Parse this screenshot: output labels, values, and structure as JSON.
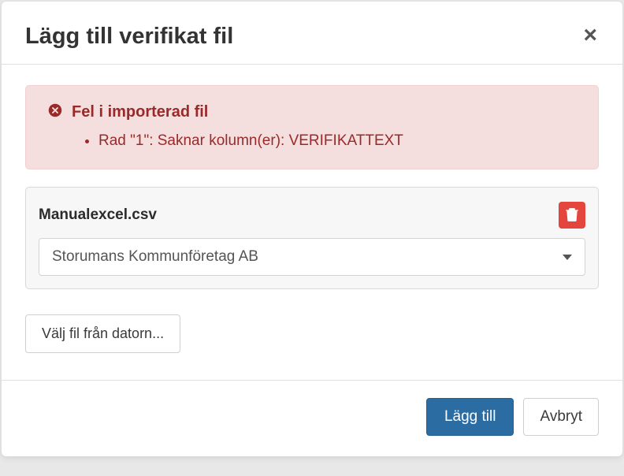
{
  "modal": {
    "title": "Lägg till verifikat fil"
  },
  "alert": {
    "title": "Fel i importerad fil",
    "items": [
      "Rad \"1\": Saknar kolumn(er): VERIFIKATTEXT"
    ]
  },
  "file": {
    "name": "Manualexcel.csv",
    "dropdown_selected": "Storumans Kommunföretag AB"
  },
  "buttons": {
    "choose_file": "Välj fil från datorn...",
    "submit": "Lägg till",
    "cancel": "Avbryt"
  }
}
